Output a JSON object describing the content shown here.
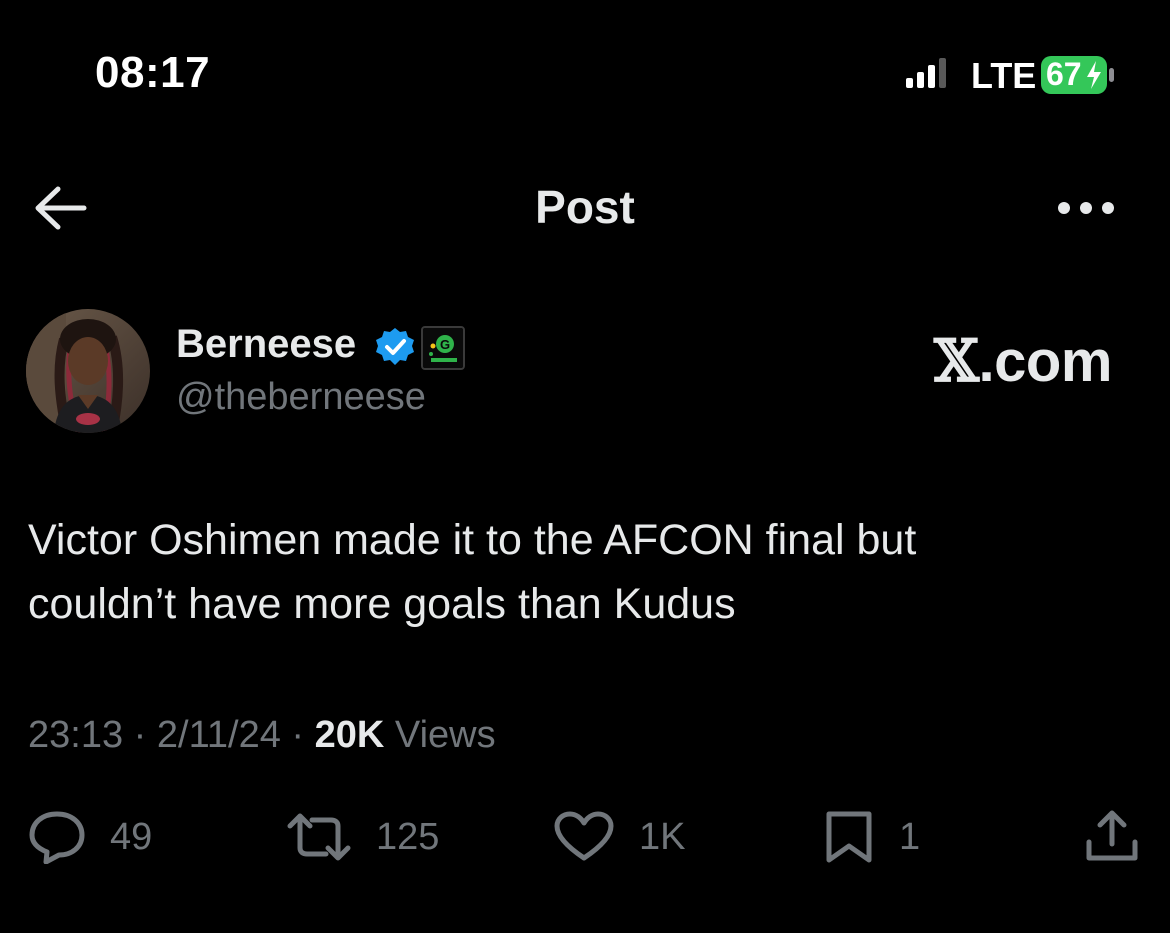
{
  "status_bar": {
    "time": "08:17",
    "network": "LTE",
    "battery": "67"
  },
  "header": {
    "title": "Post"
  },
  "author": {
    "display_name": "Berneese",
    "handle": "@theberneese",
    "verified": true
  },
  "brand": {
    "mark": "𝕏",
    "suffix": ".com"
  },
  "tweet": {
    "text": "Victor Oshimen made it to the AFCON final but\ncouldn’t have more goals than Kudus"
  },
  "meta": {
    "time": "23:13",
    "separator": "·",
    "date": "2/11/24",
    "views_count": "20K",
    "views_label": "Views"
  },
  "actions": {
    "replies": "49",
    "reposts": "125",
    "likes": "1K",
    "bookmarks": "1"
  },
  "colors": {
    "background": "#000000",
    "text_primary": "#e7e9ea",
    "text_secondary": "#71767b",
    "verified_blue": "#1d9bf0",
    "battery_green": "#34c759"
  },
  "icons": {
    "back": "arrow-left-icon",
    "more": "ellipsis-icon",
    "verified": "verified-badge-icon",
    "reply": "speech-bubble-icon",
    "repost": "retweet-icon",
    "like": "heart-icon",
    "bookmark": "bookmark-icon",
    "share": "share-upload-icon"
  }
}
